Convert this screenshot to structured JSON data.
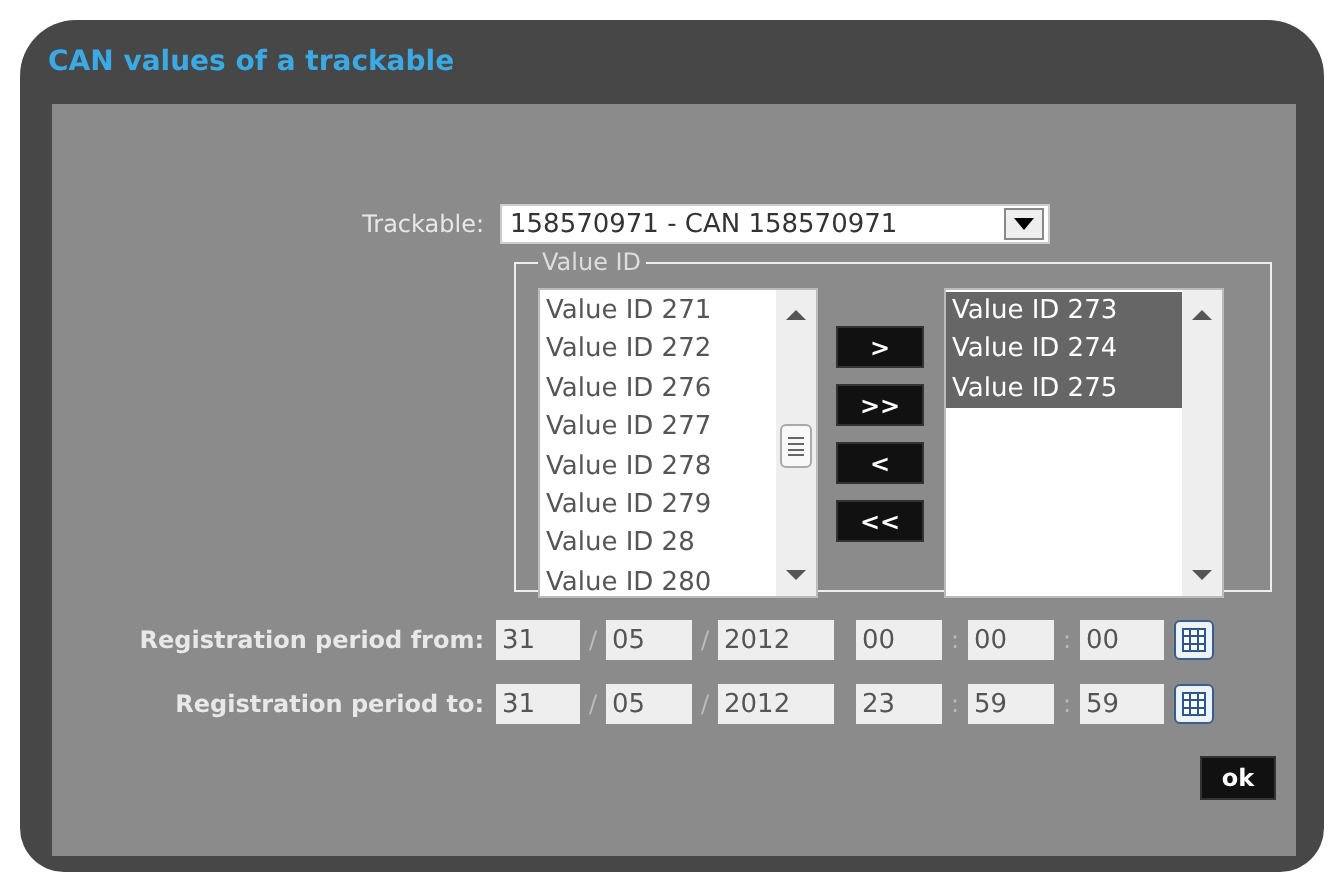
{
  "window": {
    "title": "CAN values of a trackable"
  },
  "trackable": {
    "label": "Trackable:",
    "value": "158570971 - CAN 158570971"
  },
  "value_id": {
    "legend": "Value ID",
    "available": [
      {
        "label": "Value ID 271",
        "selected": false
      },
      {
        "label": "Value ID 272",
        "selected": false
      },
      {
        "label": "Value ID 276",
        "selected": false
      },
      {
        "label": "Value ID 277",
        "selected": false
      },
      {
        "label": "Value ID 278",
        "selected": false
      },
      {
        "label": "Value ID 279",
        "selected": false
      },
      {
        "label": "Value ID 28",
        "selected": false
      },
      {
        "label": "Value ID 280",
        "selected": false
      }
    ],
    "buttons": [
      ">",
      ">>",
      "<",
      "<<"
    ],
    "chosen": [
      {
        "label": "Value ID 273",
        "selected": true
      },
      {
        "label": "Value ID 274",
        "selected": true
      },
      {
        "label": "Value ID 275",
        "selected": true
      }
    ]
  },
  "period": [
    {
      "label": "Registration period from:",
      "parts": [
        {
          "value": "31"
        },
        {
          "separator": "/",
          "value": "05"
        },
        {
          "separator": "/",
          "value": "2012"
        },
        {
          "value": "00"
        },
        {
          "separator": ":",
          "value": "00"
        },
        {
          "separator": ":",
          "value": "00"
        }
      ]
    },
    {
      "label": "Registration period to:",
      "parts": [
        {
          "value": "31"
        },
        {
          "separator": "/",
          "value": "05"
        },
        {
          "separator": "/",
          "value": "2012"
        },
        {
          "value": "23"
        },
        {
          "separator": ":",
          "value": "59"
        },
        {
          "separator": ":",
          "value": "59"
        }
      ]
    }
  ],
  "ok_button": "ok"
}
